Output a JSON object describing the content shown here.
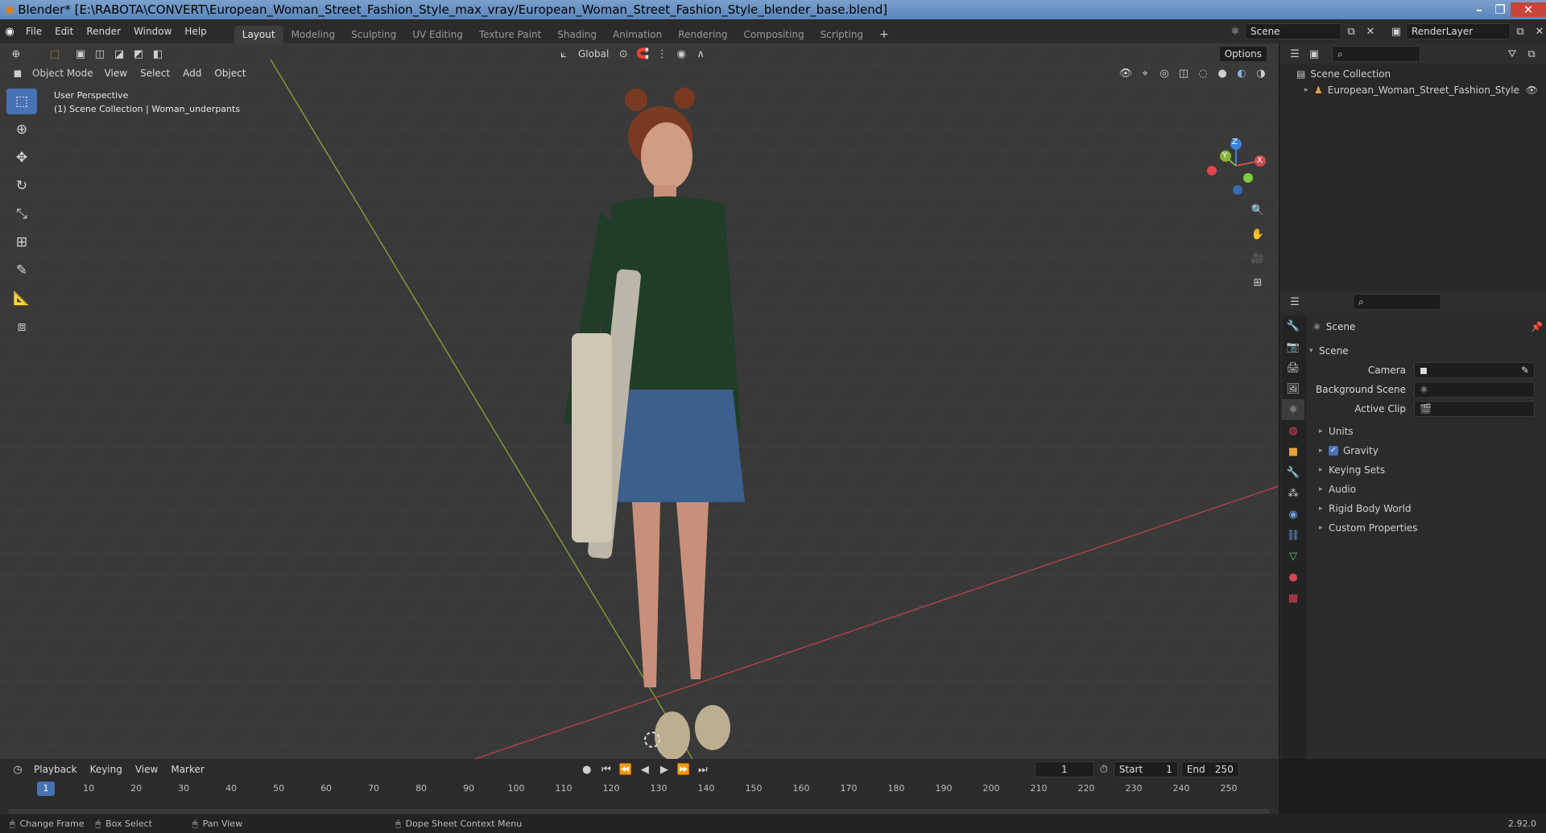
{
  "window": {
    "title": "Blender* [E:\\RABOTA\\CONVERT\\European_Woman_Street_Fashion_Style_max_vray/European_Woman_Street_Fashion_Style_blender_base.blend]",
    "min": "–",
    "max": "❐",
    "close": "✕"
  },
  "menu": [
    "File",
    "Edit",
    "Render",
    "Window",
    "Help"
  ],
  "workspaces": [
    "Layout",
    "Modeling",
    "Sculpting",
    "UV Editing",
    "Texture Paint",
    "Shading",
    "Animation",
    "Rendering",
    "Compositing",
    "Scripting"
  ],
  "add_workspace": "+",
  "scene_field": "Scene",
  "renderlayer_field": "RenderLayer",
  "viewport": {
    "mode": "Object Mode",
    "menus": [
      "View",
      "Select",
      "Add",
      "Object"
    ],
    "transform_orientation": "Global",
    "options": "Options",
    "overlay_line1": "User Perspective",
    "overlay_line2": "(1) Scene Collection | Woman_underpants",
    "gizmo": {
      "x": "X",
      "y": "Y",
      "z": "Z"
    }
  },
  "outliner": {
    "root": "Scene Collection",
    "item": "European_Woman_Street_Fashion_Style"
  },
  "properties": {
    "header": "Scene",
    "panel": "Scene",
    "camera_label": "Camera",
    "background_label": "Background Scene",
    "clip_label": "Active Clip",
    "sections": [
      "Units",
      "Gravity",
      "Keying Sets",
      "Audio",
      "Rigid Body World",
      "Custom Properties"
    ]
  },
  "timeline": {
    "menus": [
      "Playback",
      "Keying",
      "View",
      "Marker"
    ],
    "current_frame": "1",
    "start_label": "Start",
    "start": "1",
    "end_label": "End",
    "end": "250",
    "ticks": [
      "1",
      "10",
      "20",
      "30",
      "40",
      "50",
      "60",
      "70",
      "80",
      "90",
      "100",
      "110",
      "120",
      "130",
      "140",
      "150",
      "160",
      "170",
      "180",
      "190",
      "200",
      "210",
      "220",
      "230",
      "240",
      "250"
    ]
  },
  "status": {
    "change_frame": "Change Frame",
    "box_select": "Box Select",
    "pan_view": "Pan View",
    "context_menu": "Dope Sheet Context Menu",
    "version": "2.92.0"
  },
  "colors": {
    "accent": "#4772b3",
    "x_axis": "#c94f4f",
    "y_axis": "#8ab23a",
    "z_axis": "#3b83d6"
  }
}
